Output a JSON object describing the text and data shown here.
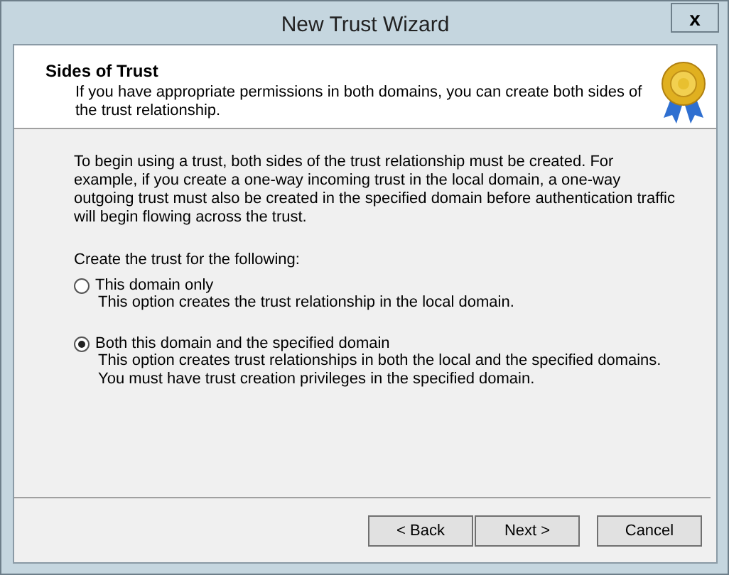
{
  "window": {
    "title": "New Trust Wizard",
    "close": "x"
  },
  "header": {
    "title": "Sides of Trust",
    "subtitle": "If you have appropriate permissions in both domains, you can create both sides of the trust relationship."
  },
  "intro": "To begin using a trust, both sides of the trust relationship must be created. For example, if you create a one-way incoming trust in the local domain, a one-way outgoing trust must also be created in the specified domain before authentication traffic will begin flowing across the trust.",
  "prompt": "Create the trust for the following:",
  "options": [
    {
      "label": "This domain only",
      "description": "This option creates the trust relationship in the local domain.",
      "selected": false
    },
    {
      "label": "Both this domain and the specified domain",
      "description": "This option creates trust relationships in both the local and the specified domains. You must have trust creation privileges in the specified domain.",
      "selected": true
    }
  ],
  "buttons": [
    "< Back",
    "Next >",
    "Cancel"
  ]
}
